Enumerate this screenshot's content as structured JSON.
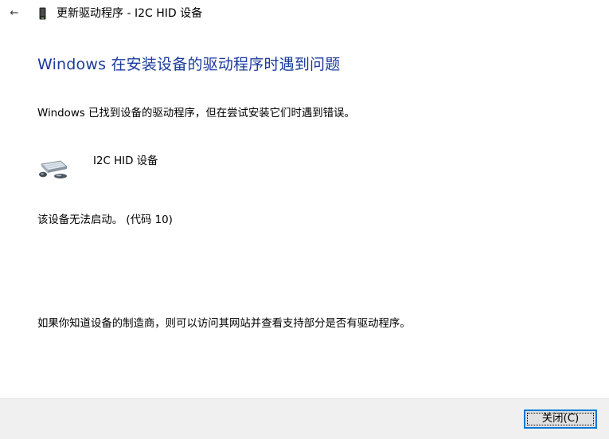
{
  "titlebar": {
    "back_icon": "back-arrow-icon",
    "back_glyph": "←",
    "device_icon": "device-icon",
    "title": "更新驱动程序 - I2C HID 设备"
  },
  "main": {
    "heading": "Windows 在安装设备的驱动程序时遇到问题",
    "intro": "Windows 已找到设备的驱动程序，但在尝试安装它们时遇到错误。",
    "device": {
      "icon": "hid-device-icon",
      "name": "I2C HID 设备"
    },
    "error_message": "该设备无法启动。 (代码 10)",
    "vendor_hint": "如果你知道设备的制造商，则可以访问其网站并查看支持部分是否有驱动程序。"
  },
  "footer": {
    "close_label": "关闭(C)"
  },
  "colors": {
    "heading": "#1a3b9c",
    "footer_bg": "#f0f0f0",
    "button_focus_border": "#0078d7"
  }
}
